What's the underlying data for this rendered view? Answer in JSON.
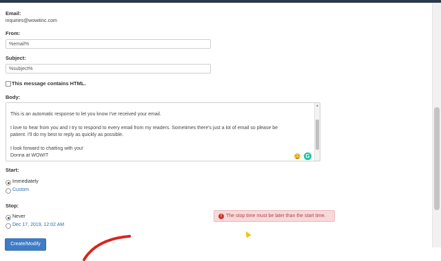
{
  "form": {
    "email_label": "Email:",
    "email_value": "inquiries@wowitinc.com",
    "from_label": "From:",
    "from_value": "%email%",
    "subject_label": "Subject:",
    "subject_value": "%subject%",
    "html_checkbox_label": "This message contains HTML.",
    "html_checked": false,
    "body_label": "Body:",
    "body_lines": [
      "This is an automatic response to let you know I've received your email.",
      "",
      "I love to hear from you and I try to respond to every email from my readers.  Sometimes there's just a lot of email so please be",
      "patient.  I'll do my best to reply as quickly as possible.",
      "",
      "I look forward to chatting with you!",
      "Donna at WOWIT"
    ],
    "start_label": "Start:",
    "start_options": [
      "Immediately",
      "Custom"
    ],
    "start_selected": "Immediately",
    "stop_label": "Stop:",
    "stop_options": [
      "Never",
      "Dec 17, 2019, 12:02 AM"
    ],
    "stop_selected": "Never",
    "submit_label": "Create/Modify"
  },
  "error": {
    "message": "The stop time must be later than the start time."
  },
  "colors": {
    "accent": "#3e7cc6",
    "link": "#2a6db5",
    "error_bg": "#f7d9d9",
    "error_text": "#a94442",
    "annotation": "#d9261c"
  }
}
